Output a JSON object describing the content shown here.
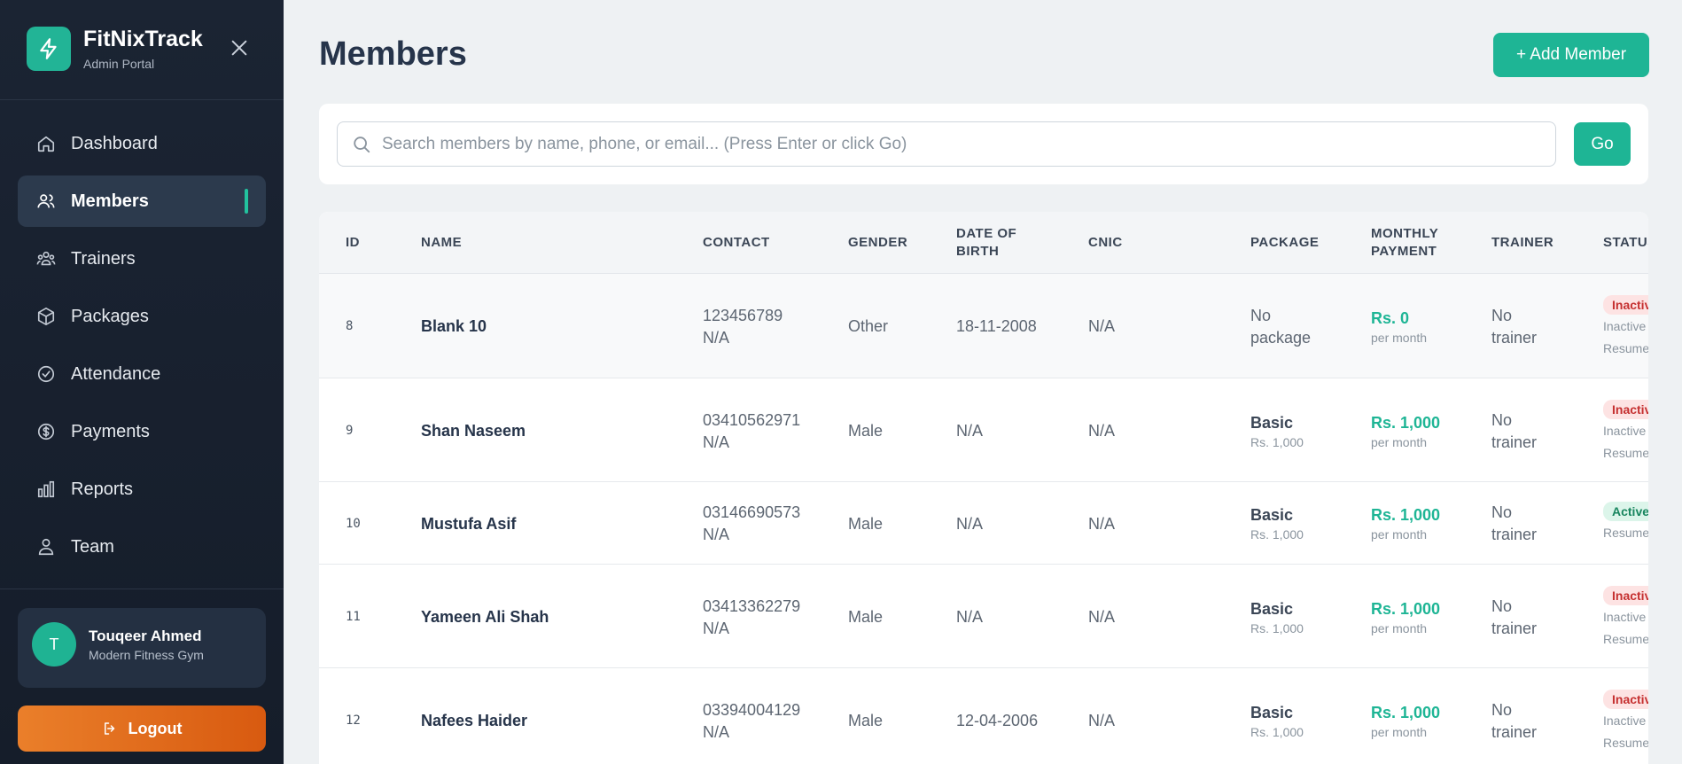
{
  "brand": {
    "name": "FitNixTrack",
    "subtitle": "Admin Portal"
  },
  "nav": {
    "items": [
      {
        "label": "Dashboard",
        "icon": "home-icon"
      },
      {
        "label": "Members",
        "icon": "users-icon",
        "active": true
      },
      {
        "label": "Trainers",
        "icon": "group-icon"
      },
      {
        "label": "Packages",
        "icon": "package-icon"
      },
      {
        "label": "Attendance",
        "icon": "check-circle-icon"
      },
      {
        "label": "Payments",
        "icon": "dollar-circle-icon"
      },
      {
        "label": "Reports",
        "icon": "bar-chart-icon"
      },
      {
        "label": "Team",
        "icon": "person-icon"
      }
    ]
  },
  "user": {
    "initial": "T",
    "name": "Touqeer Ahmed",
    "gym": "Modern Fitness Gym"
  },
  "logout_label": "Logout",
  "page": {
    "title": "Members",
    "add_button": "+ Add Member"
  },
  "search": {
    "placeholder": "Search members by name, phone, or email... (Press Enter or click Go)",
    "go_label": "Go"
  },
  "table": {
    "headers": {
      "id": "ID",
      "name": "NAME",
      "contact": "CONTACT",
      "gender": "GENDER",
      "dob_line1": "DATE OF",
      "dob_line2": "BIRTH",
      "cnic": "CNIC",
      "package": "PACKAGE",
      "payment_line1": "MONTHLY",
      "payment_line2": "PAYMENT",
      "trainer": "TRAINER",
      "status": "STATUS"
    },
    "rows": [
      {
        "id": "8",
        "name": "Blank 10",
        "phone": "123456789",
        "email": "N/A",
        "gender": "Other",
        "dob": "18-11-2008",
        "cnic": "N/A",
        "pkg_line1": "No",
        "pkg_line2": "package",
        "pay": "Rs. 0",
        "per": "per month",
        "trainer1": "No",
        "trainer2": "trainer",
        "status": "Inactive",
        "status_sub1": "Inactive",
        "status_sub2": "Resumed"
      },
      {
        "id": "9",
        "name": "Shan Naseem",
        "phone": "03410562971",
        "email": "N/A",
        "gender": "Male",
        "dob": "N/A",
        "cnic": "N/A",
        "pkg_name": "Basic",
        "pkg_price": "Rs. 1,000",
        "pay": "Rs. 1,000",
        "per": "per month",
        "trainer1": "No",
        "trainer2": "trainer",
        "status": "Inactive",
        "status_sub1": "Inactive",
        "status_sub2": "Resumed"
      },
      {
        "id": "10",
        "name": "Mustufa Asif",
        "phone": "03146690573",
        "email": "N/A",
        "gender": "Male",
        "dob": "N/A",
        "cnic": "N/A",
        "pkg_name": "Basic",
        "pkg_price": "Rs. 1,000",
        "pay": "Rs. 1,000",
        "per": "per month",
        "trainer1": "No",
        "trainer2": "trainer",
        "status": "Active",
        "status_sub1": "Resumed"
      },
      {
        "id": "11",
        "name": "Yameen Ali Shah",
        "phone": "03413362279",
        "email": "N/A",
        "gender": "Male",
        "dob": "N/A",
        "cnic": "N/A",
        "pkg_name": "Basic",
        "pkg_price": "Rs. 1,000",
        "pay": "Rs. 1,000",
        "per": "per month",
        "trainer1": "No",
        "trainer2": "trainer",
        "status": "Inactive",
        "status_sub1": "Inactive",
        "status_sub2": "Resumed"
      },
      {
        "id": "12",
        "name": "Nafees Haider",
        "phone": "03394004129",
        "email": "N/A",
        "gender": "Male",
        "dob": "12-04-2006",
        "cnic": "N/A",
        "pkg_name": "Basic",
        "pkg_price": "Rs. 1,000",
        "pay": "Rs. 1,000",
        "per": "per month",
        "trainer1": "No",
        "trainer2": "trainer",
        "status": "Inactive",
        "status_sub1": "Inactive",
        "status_sub2": "Resumed"
      }
    ]
  },
  "colors": {
    "accent": "#1eb595",
    "sidebar": "#1b2433",
    "logout": "#e0691a"
  }
}
